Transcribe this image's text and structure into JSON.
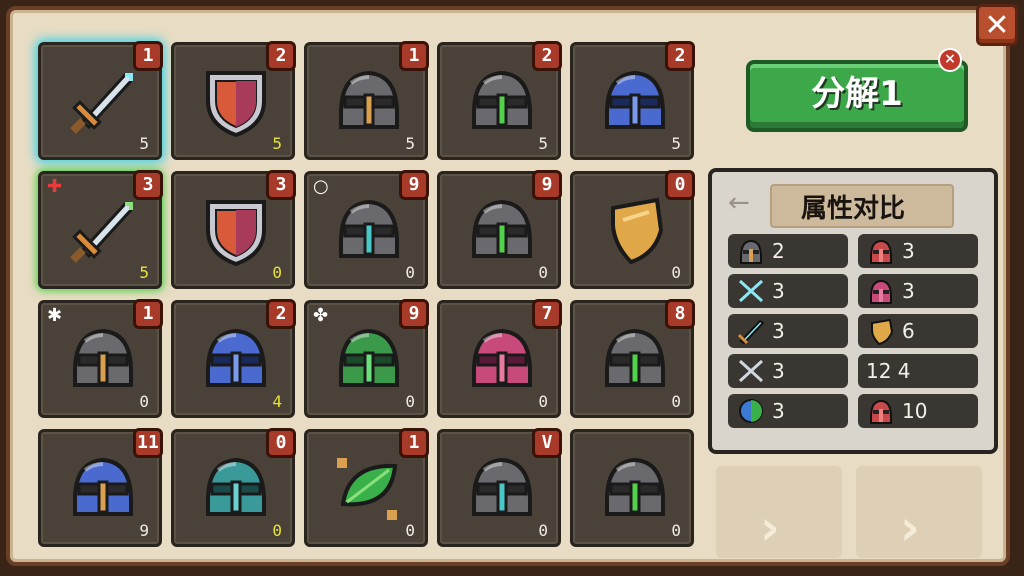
{
  "window": {
    "close_label": "✕"
  },
  "inventory": {
    "items": [
      {
        "kind": "sword-cyan",
        "badge": "1",
        "count": "5",
        "count_color": "white",
        "mark": ""
      },
      {
        "kind": "shield-red",
        "badge": "2",
        "count": "5",
        "count_color": "yellow",
        "mark": ""
      },
      {
        "kind": "helmet-gray-gold",
        "badge": "1",
        "count": "5",
        "count_color": "white",
        "mark": ""
      },
      {
        "kind": "helmet-gray-green",
        "badge": "2",
        "count": "5",
        "count_color": "white",
        "mark": ""
      },
      {
        "kind": "helmet-blue",
        "badge": "2",
        "count": "5",
        "count_color": "white",
        "mark": ""
      },
      {
        "kind": "sword-green",
        "badge": "3",
        "count": "5",
        "count_color": "yellow",
        "mark": "✚"
      },
      {
        "kind": "shield-red",
        "badge": "3",
        "count": "0",
        "count_color": "yellow",
        "mark": ""
      },
      {
        "kind": "helmet-gray-teal",
        "badge": "9",
        "count": "0",
        "count_color": "white",
        "mark": "○"
      },
      {
        "kind": "helmet-gray-green",
        "badge": "9",
        "count": "0",
        "count_color": "white",
        "mark": ""
      },
      {
        "kind": "shield-gold",
        "badge": "0",
        "count": "0",
        "count_color": "white",
        "mark": ""
      },
      {
        "kind": "helmet-gray-gold",
        "badge": "1",
        "count": "0",
        "count_color": "white",
        "mark": "✱"
      },
      {
        "kind": "helmet-blue",
        "badge": "2",
        "count": "4",
        "count_color": "yellow",
        "mark": ""
      },
      {
        "kind": "helmet-green",
        "badge": "9",
        "count": "0",
        "count_color": "white",
        "mark": "✤"
      },
      {
        "kind": "helmet-pink",
        "badge": "7",
        "count": "0",
        "count_color": "white",
        "mark": ""
      },
      {
        "kind": "helmet-gray-green",
        "badge": "8",
        "count": "0",
        "count_color": "white",
        "mark": ""
      },
      {
        "kind": "helmet-blue-gold",
        "badge": "11",
        "count": "9",
        "count_color": "white",
        "mark": ""
      },
      {
        "kind": "helmet-teal",
        "badge": "0",
        "count": "0",
        "count_color": "yellow",
        "mark": ""
      },
      {
        "kind": "leaf-green",
        "badge": "1",
        "count": "0",
        "count_color": "white",
        "mark": ""
      },
      {
        "kind": "helmet-gray-teal",
        "badge": "V",
        "count": "0",
        "count_color": "white",
        "mark": ""
      },
      {
        "kind": "helmet-gray-green",
        "badge": "",
        "count": "0",
        "count_color": "white",
        "mark": ""
      }
    ]
  },
  "decompose": {
    "label": "分解1",
    "close_label": "×"
  },
  "compare": {
    "title": "属性对比",
    "back_icon": "←",
    "stats": [
      {
        "icon": "helmet-gray",
        "value": "2"
      },
      {
        "icon": "helmet-red",
        "value": "3"
      },
      {
        "icon": "crossed-swords",
        "value": "3"
      },
      {
        "icon": "helmet-pink",
        "value": "3"
      },
      {
        "icon": "sword",
        "value": "3"
      },
      {
        "icon": "shield-gold",
        "value": "6"
      },
      {
        "icon": "crossed-arrows",
        "value": "3"
      },
      {
        "icon": "none",
        "value": "12 4"
      },
      {
        "icon": "orb-blue-green",
        "value": "3"
      },
      {
        "icon": "helmet-red",
        "value": "10"
      }
    ]
  },
  "nav": {
    "next_label": "›"
  },
  "colors": {
    "frame": "#6b3f26",
    "panel_bg": "#e8dcc4",
    "badge": "#a83a2a",
    "button_green": "#3da84a"
  }
}
